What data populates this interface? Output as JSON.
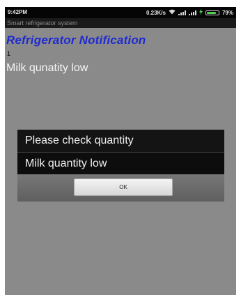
{
  "status_bar": {
    "time": "9:42PM",
    "net_speed": "0.23K/s",
    "battery_percent": "79%",
    "battery_level": 0.79,
    "icons": [
      "wifi-icon",
      "signal-icon",
      "signal-icon",
      "charging-icon",
      "battery-icon"
    ]
  },
  "app": {
    "title": "Smart refrigerator system"
  },
  "main": {
    "heading": "Refrigerator Notification",
    "count": "1",
    "message": "Milk qunatity low"
  },
  "dialog": {
    "title": "Please check quantity",
    "message": "Milk quantity low",
    "ok_label": "OK"
  },
  "colors": {
    "heading": "#1f2bd0",
    "background": "#8a8a8a",
    "dialog": "#0d0d0d",
    "battery_fill": "#4cd34c"
  }
}
